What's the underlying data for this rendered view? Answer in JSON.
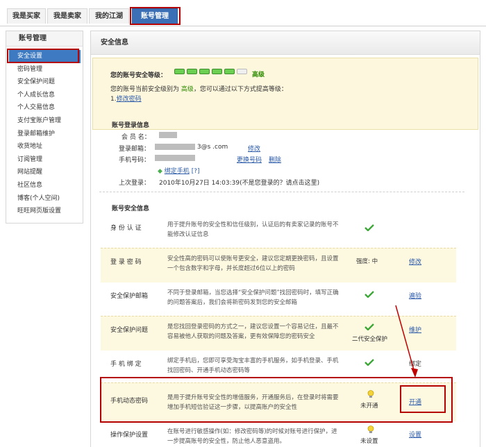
{
  "tabs": [
    {
      "label": "我是买家"
    },
    {
      "label": "我是卖家"
    },
    {
      "label": "我的江湖"
    },
    {
      "label": "账号管理"
    }
  ],
  "sidebar": {
    "title": "账号管理",
    "items": [
      {
        "label": "安全设置"
      },
      {
        "label": "密码管理"
      },
      {
        "label": "安全保护问题"
      },
      {
        "label": "个人成长信息"
      },
      {
        "label": "个人交易信息"
      },
      {
        "label": "支付宝账户管理"
      },
      {
        "label": "登录邮箱维护"
      },
      {
        "label": "收货地址"
      },
      {
        "label": "订阅管理"
      },
      {
        "label": "网站提醒"
      },
      {
        "label": "社区信息"
      },
      {
        "label": "博客(个人空间)"
      },
      {
        "label": "旺旺网页版设置"
      }
    ]
  },
  "panel": {
    "title": "安全信息",
    "level_label": "您的账号安全等级：",
    "level_bars_on": 5,
    "level_bars_total": 6,
    "level_value": "高级",
    "level_desc_prefix": "您的账号当前安全级别为",
    "level_desc_value": "高级",
    "level_desc_suffix": "，您可以通过以下方式提高等级：",
    "level_step_prefix": "1.",
    "level_step_link": "修改密码"
  },
  "login_info": {
    "heading": "账号登录信息",
    "member_label": "会 员 名：",
    "email_label": "登录邮箱：",
    "email_value": "3@s        .com",
    "email_action": "修改",
    "phone_label": "手机号码：",
    "phone_action_change": "更换号码",
    "phone_action_delete": "删除",
    "bind_link": "绑定手机",
    "bind_help": "[?]",
    "last_login_label": "上次登录：",
    "last_login_value": "2010年10月27日 14:03:39(不是您登录的？请点击这里)"
  },
  "security": {
    "heading": "账号安全信息",
    "rows": [
      {
        "name": "身 份 认 证",
        "desc": "用于提升账号的安全性和信任级别，认证后的有卖家记录的账号不能修改认证信息",
        "status": "",
        "action": ""
      },
      {
        "name": "登 录 密 码",
        "desc": "安全性高的密码可以使账号更安全，建议您定期更换密码，且设置一个包含数字和字母，并长度超过6位以上的密码",
        "status": "强度: 中",
        "action": "修改"
      },
      {
        "name": "安全保护邮箱",
        "desc": "不同于登录邮箱，当您选择“安全保护问题”找回密码时，填写正确的问题答案后，我们会将新密码发到您的安全邮箱",
        "status": "",
        "action": "遍验"
      },
      {
        "name": "安全保护问题",
        "desc": "是您找回登录密码的方式之一，建议您设置一个容易记住，且最不容易被他人获取的问题及答案，更有效保障您的密码安全",
        "status": "二代安全保护",
        "action": "维护"
      },
      {
        "name": "手 机 绑 定",
        "desc": "绑定手机后，您即可享受淘宝丰富的手机服务，如手机登录、手机找回密码、开通手机动态密码等",
        "status": "",
        "action": "绑定"
      },
      {
        "name": "手机动态密码",
        "desc": "是用于提升账号安全性的增值服务，开通服务后，在登录时将需要增加手机短信验证这一步骤，以提高账户的安全性",
        "status": "未开通",
        "action": "开通"
      },
      {
        "name": "操作保护设置",
        "desc": "在账号进行敏感操作(如：修改密码等)的时候对账号进行保护，进一步提高账号的安全性，防止他人恶意盗用。",
        "status": "未设置",
        "action": "设置"
      }
    ]
  },
  "colors": {
    "accent": "#3b6fb6",
    "highlight": "#b40000",
    "ok_green": "#2d8a00"
  }
}
